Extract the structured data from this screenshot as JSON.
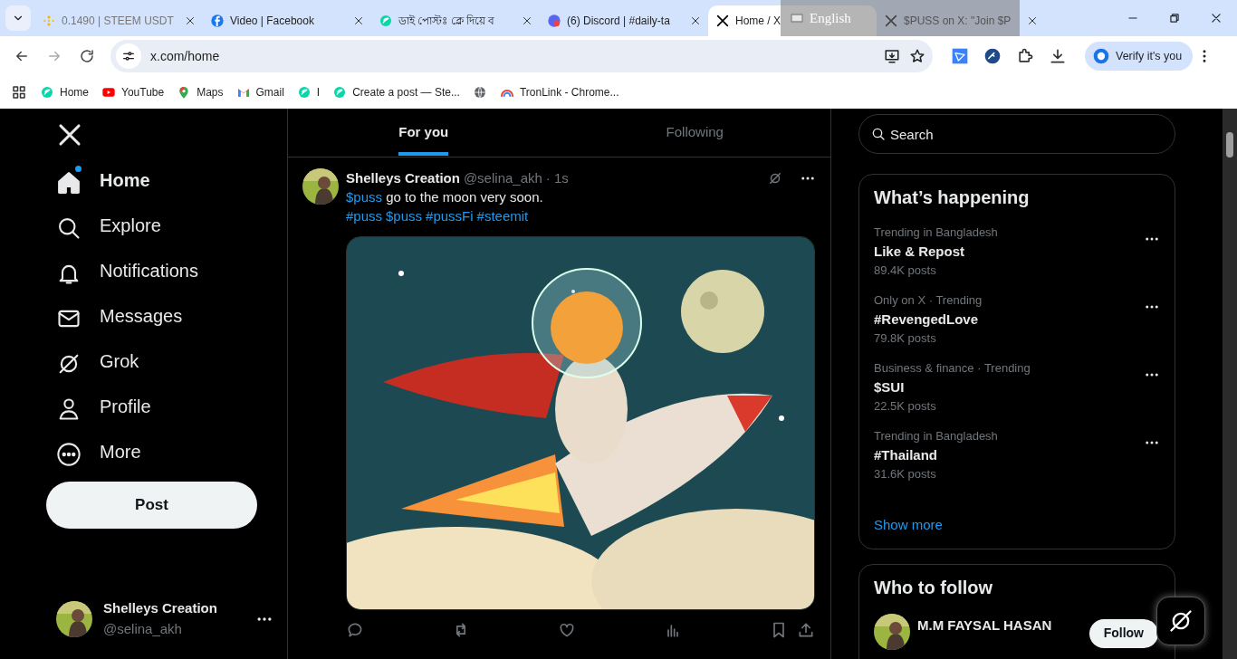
{
  "browser": {
    "tabs": [
      {
        "title": "0.1490 | STEEM USDT",
        "kind": "binance",
        "selected": false
      },
      {
        "title": "Video | Facebook",
        "kind": "facebook",
        "selected": false
      },
      {
        "title": "ডাই পোস্টঃ ক্লে দিয়ে ব",
        "kind": "steemit",
        "selected": false
      },
      {
        "title": "(6) Discord | #daily-ta",
        "kind": "discord",
        "selected": false
      },
      {
        "title": "Home / X",
        "kind": "x",
        "selected": true
      },
      {
        "title": "$PUSS on X: \"Join $P",
        "kind": "x",
        "selected": false
      }
    ],
    "address": "x.com/home",
    "profile_button": "Verify it's you",
    "bookmarks": [
      {
        "label": "Home",
        "kind": "steemit"
      },
      {
        "label": "YouTube",
        "kind": "youtube"
      },
      {
        "label": "Maps",
        "kind": "maps"
      },
      {
        "label": "Gmail",
        "kind": "gmail"
      },
      {
        "label": "I",
        "kind": "steemit"
      },
      {
        "label": "Create a post — Ste...",
        "kind": "steemit"
      },
      {
        "kind": "globe"
      },
      {
        "label": "TronLink - Chrome...",
        "kind": "tronlink"
      }
    ]
  },
  "language_bar": {
    "label": "English"
  },
  "sidebar": {
    "items": [
      {
        "label": "Home",
        "kind": "home",
        "selected": true,
        "unread": true
      },
      {
        "label": "Explore",
        "kind": "search",
        "selected": false,
        "unread": false
      },
      {
        "label": "Notifications",
        "kind": "bell",
        "selected": false,
        "unread": false
      },
      {
        "label": "Messages",
        "kind": "mail",
        "selected": false,
        "unread": false
      },
      {
        "label": "Grok",
        "kind": "grok",
        "selected": false,
        "unread": false
      },
      {
        "label": "Profile",
        "kind": "person",
        "selected": false,
        "unread": false
      },
      {
        "label": "More",
        "kind": "more",
        "selected": false,
        "unread": false
      }
    ],
    "post_button": "Post",
    "account": {
      "name": "Shelleys Creation",
      "handle": "@selina_akh"
    }
  },
  "feed": {
    "tabs": [
      {
        "label": "For you",
        "selected": true
      },
      {
        "label": "Following",
        "selected": false
      }
    ],
    "post": {
      "name": "Shelleys Creation",
      "handle": "@selina_akh",
      "time": "· 1s",
      "line": [
        {
          "kind": "link",
          "text": "$puss"
        },
        {
          "kind": "plain",
          "text": " go to the moon very soon."
        }
      ],
      "tags": [
        "#puss",
        "$puss",
        "#pussFi",
        "#steemit"
      ]
    }
  },
  "search": {
    "placeholder": "Search"
  },
  "trends": {
    "title": "What’s happening",
    "items": [
      {
        "context": "Trending in Bangladesh",
        "topic": "Like & Repost",
        "count": "89.4K posts"
      },
      {
        "context": "Only on X · Trending",
        "topic": "#RevengedLove",
        "count": "79.8K posts"
      },
      {
        "context": "Business & finance · Trending",
        "topic": "$SUI",
        "count": "22.5K posts"
      },
      {
        "context": "Trending in Bangladesh",
        "topic": "#Thailand",
        "count": "31.6K posts"
      }
    ],
    "more": "Show more"
  },
  "who_to_follow": {
    "title": "Who to follow",
    "accounts": [
      {
        "name": "M.M FAYSAL HASAN",
        "button": "Follow"
      }
    ]
  }
}
